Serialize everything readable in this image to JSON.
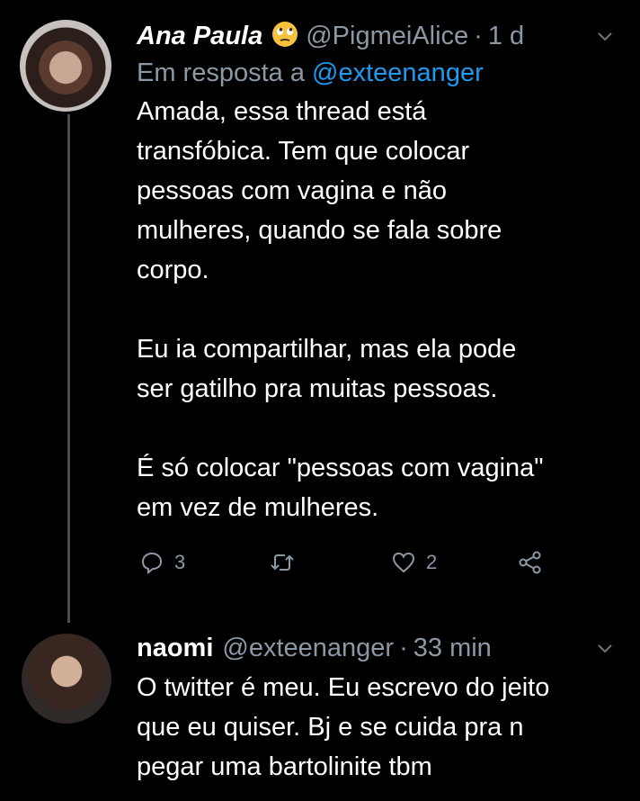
{
  "tweets": [
    {
      "display_name": "Ana Paula",
      "emoji_icon": "face-with-rolling-eyes-emoji",
      "handle": "@PigmeiAlice",
      "separator": "·",
      "timestamp": "1 d",
      "reply_prefix": "Em resposta a",
      "reply_mention": "@exteenanger",
      "text": "Amada, essa thread está\ntransfóbica. Tem que colocar\npessoas com vagina e não\nmulheres, quando se fala sobre\ncorpo.\n\nEu ia compartilhar, mas ela pode\nser gatilho pra muitas pessoas.\n\nÉ só colocar \"pessoas com vagina\"\nem vez de mulheres.",
      "actions": {
        "reply_count": "3",
        "retweet_count": "",
        "like_count": "2"
      }
    },
    {
      "display_name": "naomi",
      "handle": "@exteenanger",
      "separator": "·",
      "timestamp": "33 min",
      "text": "O twitter é meu. Eu escrevo do jeito\nque eu quiser. Bj e se cuida pra n\npegar uma bartolinite tbm"
    }
  ],
  "colors": {
    "background": "#000000",
    "text": "#ffffff",
    "muted": "#8b98a5",
    "mention": "#1d9bf0",
    "thread_line": "#4a4d52"
  }
}
